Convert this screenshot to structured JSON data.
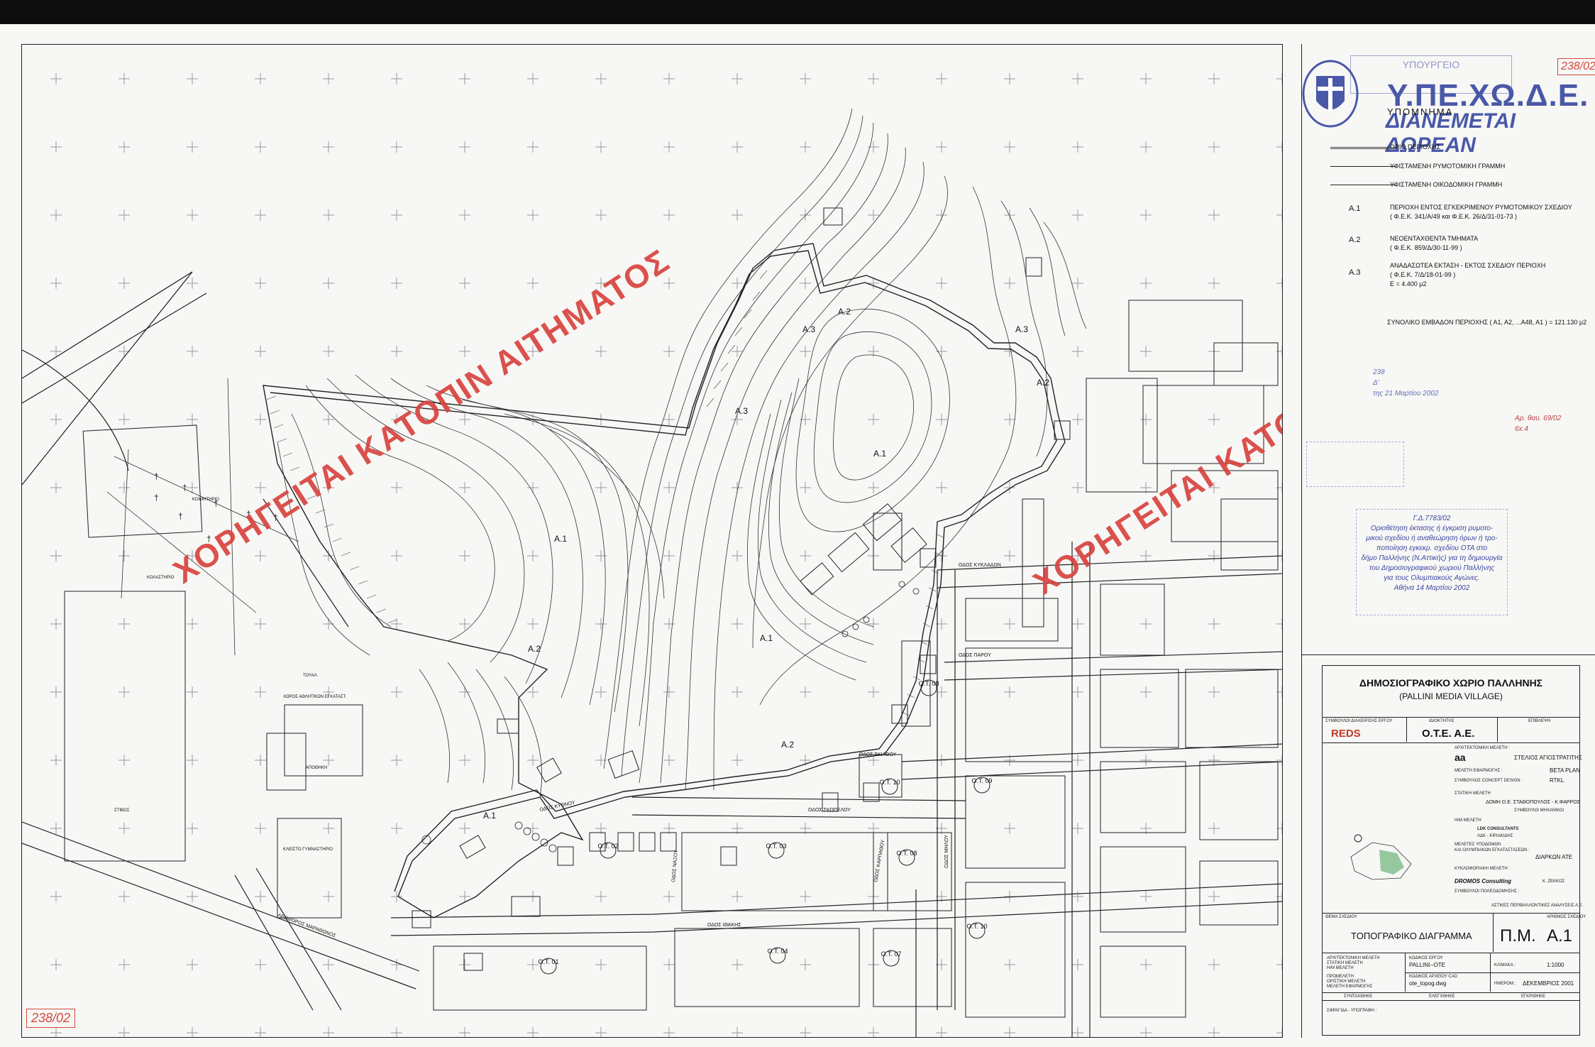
{
  "watermark": {
    "text": "ΧΟΡΗΓΕΙΤΑΙ ΚΑΤΟΠΙΝ ΑΙΤΗΜΑΤΟΣ",
    "color": "#d8433f"
  },
  "stamps": {
    "ministry_abbr": "Υ.ΠΕ.ΧΩ.Δ.Ε.",
    "ministry_free": "ΔΙΑΝΕΜΕΤΑΙ ΔΩΡΕΑΝ",
    "ministry_top": "ΥΠΟΥΡΓΕΙΟ",
    "sheet_number": "238/02",
    "gazette_line1": "238",
    "gazette_line2": "Δ'",
    "gazette_line3": "της 21 Μαρτίου 2002",
    "ref": "Αρ. θαυ. 69/02",
    "ref2": "6x.4",
    "decision_code": "Γ.Δ.7783/02",
    "decision_line1": "Οριοθέτηση έκτασης ή έγκριση ρυμοτο-",
    "decision_line2": "μικού σχεδίου ή αναθεώρηση όρων ή τρο-",
    "decision_line3": "ποποίηση εγκεκρ. σχεδίου ΟΤΑ στο",
    "decision_line4": "δήμο Παλλήνης (Ν.Αττικής) για τη δημιουργία",
    "decision_line5": "του Δημοσιογραφικού χωριού Παλλήνης",
    "decision_line6": "για τους Ολυμπιακούς Αγώνες.",
    "decision_line7": "Αθήνα 14 Μαρτίου 2002"
  },
  "legend": {
    "title": "ΥΠΟΜΝΗΜΑ",
    "items": [
      {
        "code": "",
        "text": "ΟΡΙΟ ΠΕΡΙΟΧΗΣ"
      },
      {
        "code": "",
        "text": "ΥΦΙΣΤΑΜΕΝΗ ΡΥΜΟΤΟΜΙΚΗ ΓΡΑΜΜΗ"
      },
      {
        "code": "",
        "text": "ΥΦΙΣΤΑΜΕΝΗ ΟΙΚΟΔΟΜΙΚΗ ΓΡΑΜΜΗ"
      },
      {
        "code": "Α.1",
        "text": "ΠΕΡΙΟΧΗ ΕΝΤΟΣ ΕΓΚΕΚΡΙΜΕΝΟΥ ΡΥΜΟΤΟΜΙΚΟΥ ΣΧΕΔΙΟΥ",
        "sub": "( Φ.Ε.Κ. 341/Α/49 και Φ.Ε.Κ. 26/Δ/31-01-73 )"
      },
      {
        "code": "Α.2",
        "text": "ΝΕΟΕΝΤΑΧΘΕΝΤΑ ΤΜΗΜΑΤΑ",
        "sub": "( Φ.Ε.Κ. 859/Δ/30-11-99 )"
      },
      {
        "code": "Α.3",
        "text": "ΑΝΑΔΑΣΩΤΕΑ ΕΚΤΑΣΗ - ΕΚΤΟΣ ΣΧΕΔΙΟΥ ΠΕΡΙΟΧΗ",
        "sub": "( Φ.Ε.Κ. 7/Δ/18-01-99 )",
        "sub2": "Ε = 4.400 μ2"
      }
    ],
    "total": "ΣΥΝΟΛΙΚΟ ΕΜΒΑΔΟΝ ΠΕΡΙΟΧΗΣ ( Α1, Α2, ...Α48, Α1 ) = 121.130 μ2"
  },
  "title_block": {
    "project": "ΔΗΜΟΣΙΟΓΡΑΦΙΚΟ ΧΩΡΙΟ ΠΑΛΛΗΝΗΣ",
    "project_en": "(PALLINI MEDIA VILLAGE)",
    "advisor_label": "ΣΥΜΒΟΥΛΟΙ ΔΙΑΧΕΙΡΙΣΗΣ ΕΡΓΟΥ",
    "advisor": "REDS",
    "owner_label": "ΙΔΙΟΚΤΗΤΗΣ",
    "owner": "Ο.Τ.Ε. Α.Ε.",
    "supervision_label": "ΕΠΙΒΛΕΨΗ",
    "arch_label": "ΑΡΧΙΤΕΚΤΟΝΙΚΗ ΜΕΛΕΤΗ :",
    "arch_firm": "aa",
    "arch_person": "ΣΤΕΛΙΟΣ ΑΓΙΟΣΤΡΑΤΙΤΗΣ",
    "apply_label": "ΜΕΛΕΤΗ ΕΦΑΡΜΟΓΗΣ :",
    "apply_value": "BETA PLAN",
    "concept_label": "ΣΥΜΒΟΥΛΟΣ CONCEPT DESIGN :",
    "concept_value": "RTKL",
    "static_label": "ΣΤΑΤΙΚΗ ΜΕΛΕΤΗ",
    "static_value": "ΔΟΜΗ Ο.Ε. ΣΤΑΘΟΠΟΥΛΟΣ - Κ.ΦΑΡΡΟΣ",
    "static_sub": "ΣΥΜΒΟΥΛΟΙ ΜΗΧΑΝΙΚΟΙ",
    "hm_label": "Η/Μ ΜΕΛΕΤΗ",
    "hm_value": "LDK CONSULTANTS",
    "hm_sub": "ΛΔΚ - ΚΙΡΙΑΚΙΔΗΣ",
    "infra_label": "ΜΕΛΕΤΕΣ ΥΠΟΔΟΜΩΝ",
    "infra_label2": "ΚΑΙ ΟΛΥΜΠΙΑΚΩΝ ΕΓΚΑΤΑΣΤΑΣΕΩΝ :",
    "infra_value": "ΔΙΑΡΚΩΝ ΑΤΕ",
    "traffic_label": "ΚΥΚΛΟΦΟΡΙΑΚΗ ΜΕΛΕΤΗ :",
    "traffic_firm": "DROMOS Consulting",
    "traffic_person": "Κ. ΖΕΚΚΟΣ",
    "urban_label": "ΣΥΜΒΟΥΛΟΙ ΠΟΛΕΟΔΟΜΗΣΗΣ :",
    "urban_firm": "ΑΣΤΙΚΕΣ ΠΕΡΙΒΑΛΛΟΝΤΙΚΕΣ ΑΝΑΛΥΣΕΙΣ Α.Ε.",
    "subject_label": "ΘΕΜΑ ΣΧΕΔΙΟΥ",
    "subject": "ΤΟΠΟΓΡΑΦΙΚΟ ΔΙΑΓΡΑΜΜΑ",
    "drawing_no_label": "ΑΡΙΘΜΟΣ ΣΧΕΔΙΟΥ",
    "drawing_prefix": "Π.Μ.",
    "drawing_no": "Α.1",
    "code_label": "ΚΩΔΙΚΟΣ ΕΡΓΟΥ",
    "code": "PALLINI--OTE",
    "scale_label": "ΚΛΙΜΑΚΑ :",
    "scale": "1:1000",
    "cad_label": "ΚΩΔΙΚΟΣ ΑΡΧΕΙΟΥ CAD",
    "cad": "ote_topog.dwg",
    "date_label": "ΗΜΕΡΟΜ.:",
    "date": "ΔΕΚΕΜΒΡΙΟΣ 2001",
    "stack1": "ΑΡΧΙΤΕΚΤΟΝΙΚΗ ΜΕΛΕΤΗ",
    "stack2": "ΣΤΑΤΙΚΗ ΜΕΛΕΤΗ",
    "stack3": "Η/Μ ΜΕΛΕΤΗ",
    "stack4": "ΠΡΟΜΕΛΕΤΗ",
    "stack5": "ΟΡΙΣΤΙΚΗ ΜΕΛΕΤΗ",
    "stack6": "ΜΕΛΕΤΗ ΕΦΑΡΜΟΓΗΣ",
    "compiled_label": "ΣΥΝΤΑΧΘΗΚΕ",
    "checked_label": "ΕΛΕΓΧΘΗΚΕ",
    "approved_label": "ΕΓΚΡΙΘΗΚΕ",
    "seal_label": "ΣΦΡΑΓΙΔΑ - ΥΠΟΓΡΑΦΗ :"
  },
  "map_labels": {
    "areas": [
      "Α.1",
      "Α.1",
      "Α.1",
      "Α.1",
      "Α.2",
      "Α.2",
      "Α.2",
      "Α.2",
      "Α.3",
      "Α.3",
      "Α.3"
    ],
    "blocks": [
      "Ο.Τ. 01",
      "Ο.Τ. 02",
      "Ο.Τ. 03",
      "Ο.Τ. 04",
      "Ο.Τ. 07",
      "Ο.Τ. 08",
      "Ο.Τ. 08",
      "Ο.Τ. 09",
      "Ο.Τ. 10",
      "Ο.Τ. 10"
    ],
    "streets": [
      "ΛΕΩΦΟΡΟΣ ΜΑΡΑΘΩΝΟΣ",
      "ΟΔΟΣ ΙΘΑΚΗΣ",
      "ΟΔΟΣ ΣΚΟΠΕΛΟΥ",
      "ΟΔΟΣ ΣΚΙΑΘΟΥ",
      "ΟΔΟΣ ΚΥΘΝΟΥ",
      "ΟΔΟΣ ΚΥΚΛΑΔΩΝ",
      "ΟΔΟΣ ΠΑΡΟΥ",
      "ΟΔΟΣ ΚΑΡΠΑΘΟΥ",
      "ΟΔΟΣ ΜΗΛΟΥ",
      "ΟΔΟΣ ΝΑΞΟΥ"
    ],
    "facilities": [
      "ΚΟΙΜΗΤΗΡΙΟ",
      "ΚΟΛΑΣΤΗΡΙΟ",
      "ΤΟΥΑΛ.",
      "ΧΩΡΟΣ ΑΘΛΗΤΙΚΩΝ ΕΓΚΑΤΑΣΤ.",
      "ΑΠΟΘΗΚΗ",
      "ΚΛΕΙΣΤΟ ΓΥΜΝΑΣΤΗΡΙΟ",
      "ΣΤΙΒΟΣ"
    ]
  }
}
